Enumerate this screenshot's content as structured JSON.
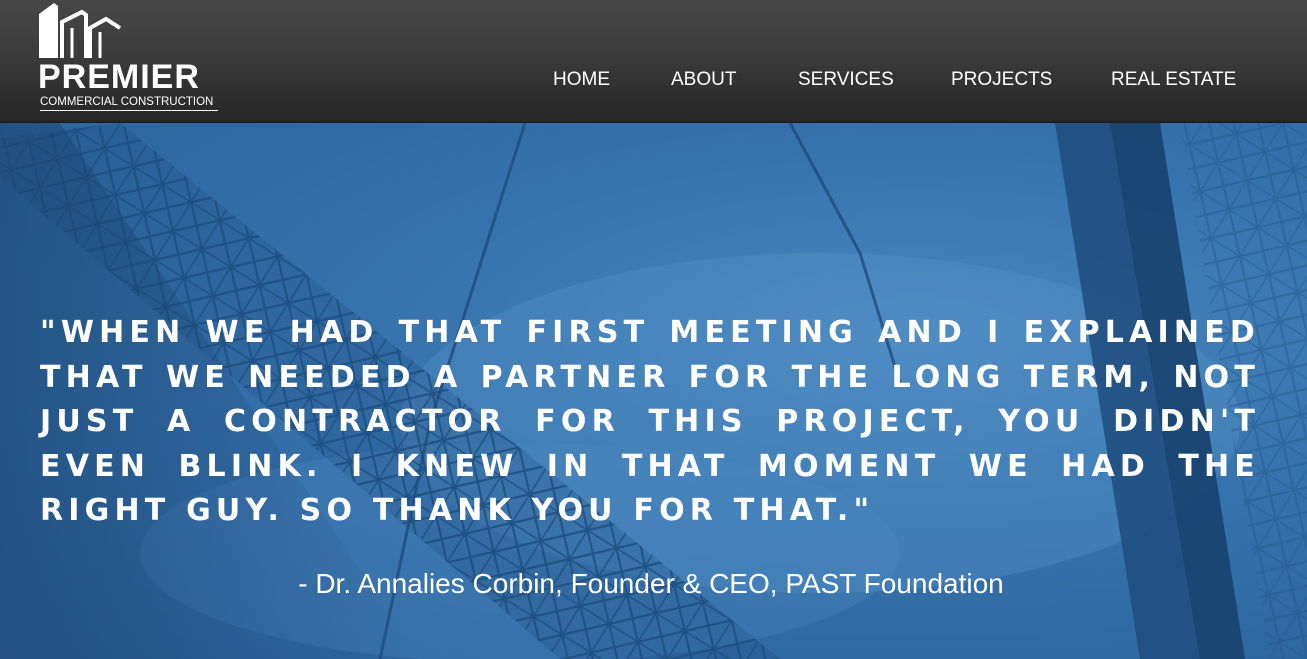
{
  "header": {
    "logo": {
      "brand": "PREMIER",
      "tagline": "COMMERCIAL CONSTRUCTION"
    },
    "nav": [
      {
        "label": "HOME",
        "name": "nav-home"
      },
      {
        "label": "ABOUT",
        "name": "nav-about"
      },
      {
        "label": "SERVICES",
        "name": "nav-services"
      },
      {
        "label": "PROJECTS",
        "name": "nav-projects"
      },
      {
        "label": "REAL ESTATE",
        "name": "nav-real-estate"
      }
    ]
  },
  "hero": {
    "background_image": "steel-beams-sky",
    "accent_color": "#2e6aa3",
    "quote": "\"When we had that first meeting and I explained that we needed a partner for the long term, not just a contractor for this project, you didn't even blink.  I knew in that moment we had the right guy.  So thank you for that.\"",
    "attribution": "- Dr. Annalies Corbin, Founder & CEO, PAST Foundation"
  }
}
